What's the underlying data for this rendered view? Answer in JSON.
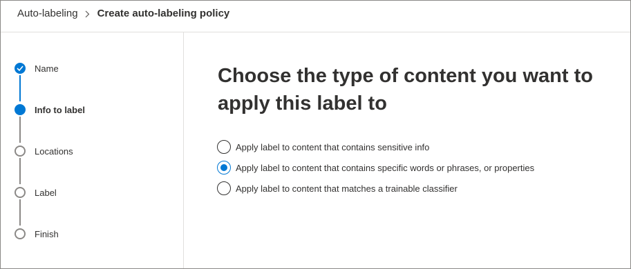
{
  "breadcrumb": {
    "parent": "Auto-labeling",
    "separator_icon": "chevron-right-icon",
    "current": "Create auto-labeling policy"
  },
  "wizard": {
    "steps": [
      {
        "label": "Name",
        "status": "completed",
        "icon": "checkmark-icon"
      },
      {
        "label": "Info to label",
        "status": "current",
        "icon": "filled-circle-icon"
      },
      {
        "label": "Locations",
        "status": "pending",
        "icon": "empty-circle-icon"
      },
      {
        "label": "Label",
        "status": "pending",
        "icon": "empty-circle-icon"
      },
      {
        "label": "Finish",
        "status": "pending",
        "icon": "empty-circle-icon"
      }
    ]
  },
  "main": {
    "title": "Choose the type of content you want to apply this label to",
    "options": [
      {
        "label": "Apply label to content that contains sensitive info",
        "selected": false
      },
      {
        "label": "Apply label to content that contains specific words or phrases, or properties",
        "selected": true
      },
      {
        "label": "Apply label to content that matches a trainable classifier",
        "selected": false
      }
    ]
  },
  "colors": {
    "accent": "#0078d4",
    "text": "#323130",
    "inactive": "#8a8886",
    "divider": "#e1dfdd"
  }
}
